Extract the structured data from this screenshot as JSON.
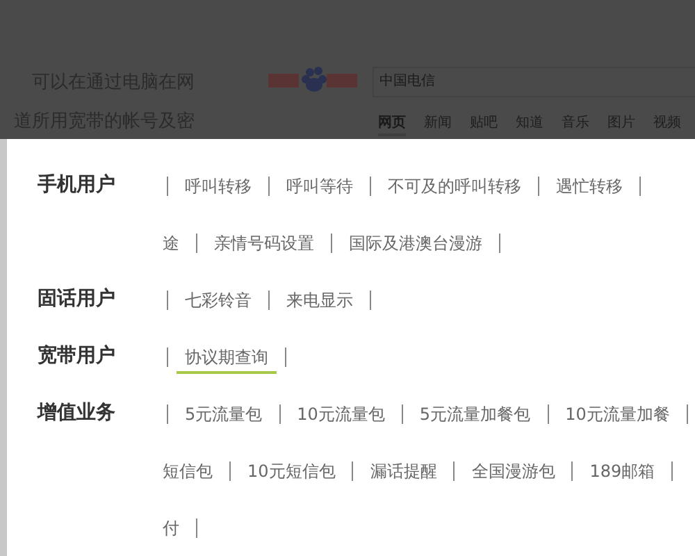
{
  "background_page": {
    "intro_lines": [
      "可以在通过电脑在网",
      "道所用宽带的帐号及密"
    ],
    "search_box": {
      "value": "中国电信"
    },
    "search_tabs": [
      {
        "label": "网页",
        "selected": true
      },
      {
        "label": "新闻",
        "selected": false
      },
      {
        "label": "贴吧",
        "selected": false
      },
      {
        "label": "知道",
        "selected": false
      },
      {
        "label": "音乐",
        "selected": false
      },
      {
        "label": "图片",
        "selected": false
      },
      {
        "label": "视频",
        "selected": false
      }
    ]
  },
  "menu": {
    "categories": [
      {
        "label": "手机用户",
        "lines": [
          [
            {
              "text": "呼叫转移",
              "selected": false
            },
            {
              "text": "呼叫等待",
              "selected": false
            },
            {
              "text": "不可及的呼叫转移",
              "selected": false
            },
            {
              "text": "遇忙转移",
              "selected": false
            }
          ],
          [
            {
              "text": "途",
              "selected": false
            },
            {
              "text": "亲情号码设置",
              "selected": false
            },
            {
              "text": "国际及港澳台漫游",
              "selected": false
            }
          ]
        ]
      },
      {
        "label": "固话用户",
        "lines": [
          [
            {
              "text": "七彩铃音",
              "selected": false
            },
            {
              "text": "来电显示",
              "selected": false
            }
          ]
        ]
      },
      {
        "label": "宽带用户",
        "lines": [
          [
            {
              "text": "协议期查询",
              "selected": true
            }
          ]
        ]
      },
      {
        "label": "增值业务",
        "lines": [
          [
            {
              "text": "5元流量包",
              "selected": false
            },
            {
              "text": "10元流量包",
              "selected": false
            },
            {
              "text": "5元流量加餐包",
              "selected": false
            },
            {
              "text": "10元流量加餐",
              "selected": false
            }
          ],
          [
            {
              "text": "短信包",
              "selected": false
            },
            {
              "text": "10元短信包",
              "selected": false
            },
            {
              "text": "漏话提醒",
              "selected": false
            },
            {
              "text": "全国漫游包",
              "selected": false
            },
            {
              "text": "189邮箱",
              "selected": false
            }
          ],
          [
            {
              "text": "付",
              "selected": false
            }
          ]
        ]
      }
    ]
  }
}
